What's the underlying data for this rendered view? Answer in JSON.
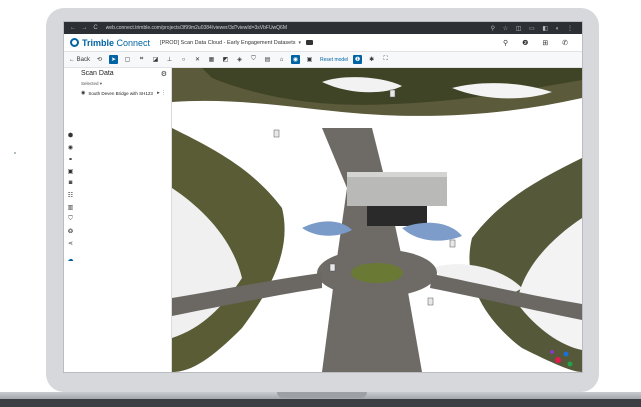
{
  "browser": {
    "nav": "← → C",
    "url": "web.connect.trimble.com/projects/3f99m2u0384/viewer/3d?viewId=3sVbFUwQ6M",
    "icons": "⚲ ☆ ◫ ▭ ◧ ◐ ⋮"
  },
  "app": {
    "brand_main": "Trimble",
    "brand_second": " Connect",
    "project": "[PROD] Scan Data Cloud - Early Engagement Datasets",
    "header_icons": "⚲ ❷ ⊞ ✆"
  },
  "toolbar": {
    "back_label": "← Back",
    "reset_label": "Reset model"
  },
  "panel": {
    "title": "Scan Data",
    "selected_label": "Selected ▾",
    "item_label": "South Deven Bridge with SH123"
  },
  "colors": {
    "accent": "#0063a3",
    "grass_dark": "#4a5a2a",
    "road": "#6e6a66"
  }
}
